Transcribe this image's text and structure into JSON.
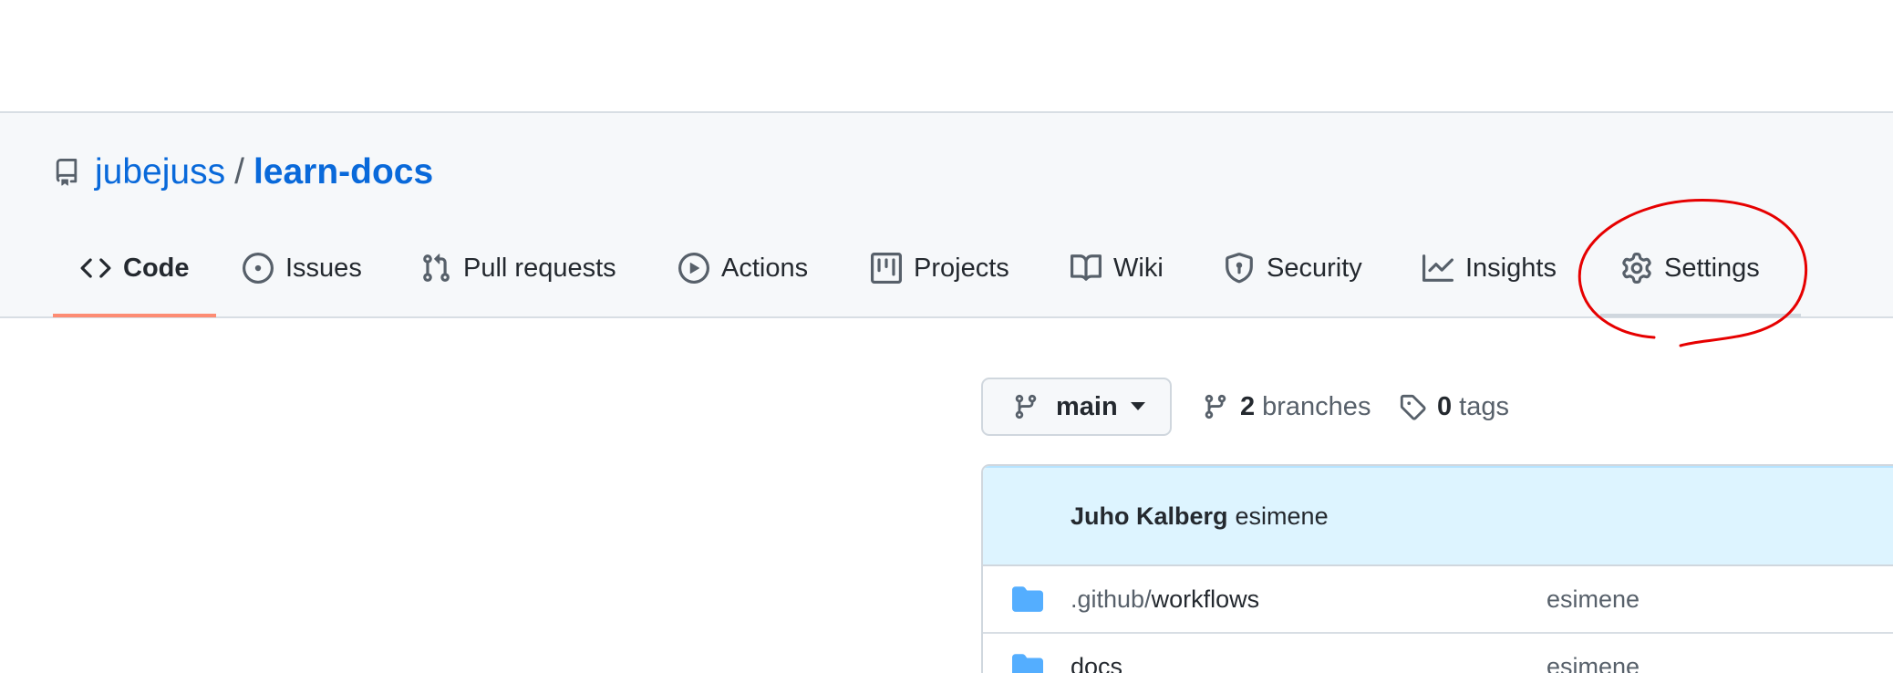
{
  "repo": {
    "owner": "jubejuss",
    "separator": "/",
    "name": "learn-docs",
    "icon": "repo-icon"
  },
  "tabs": [
    {
      "label": "Code",
      "icon": "code-icon",
      "selected": true
    },
    {
      "label": "Issues",
      "icon": "issue-opened-icon",
      "selected": false
    },
    {
      "label": "Pull requests",
      "icon": "git-pull-request-icon",
      "selected": false
    },
    {
      "label": "Actions",
      "icon": "play-icon",
      "selected": false
    },
    {
      "label": "Projects",
      "icon": "table-icon",
      "selected": false
    },
    {
      "label": "Wiki",
      "icon": "book-icon",
      "selected": false
    },
    {
      "label": "Security",
      "icon": "shield-icon",
      "selected": false
    },
    {
      "label": "Insights",
      "icon": "graph-icon",
      "selected": false
    },
    {
      "label": "Settings",
      "icon": "gear-icon",
      "selected": false
    }
  ],
  "branch": {
    "current": "main",
    "branches_count": "2",
    "branches_label": "branches",
    "tags_count": "0",
    "tags_label": "tags"
  },
  "latest_commit": {
    "author": "Juho Kalberg",
    "message": "esimene"
  },
  "files": [
    {
      "prefix": ".github/",
      "name": "workflows",
      "type": "folder",
      "commit_message": "esimene"
    },
    {
      "prefix": "",
      "name": "docs",
      "type": "folder",
      "commit_message": "esimene"
    }
  ],
  "colors": {
    "link": "#0969da",
    "selected_tab_underline": "#fd8c73",
    "annotation": "#e60000",
    "folder": "#54aeff"
  }
}
